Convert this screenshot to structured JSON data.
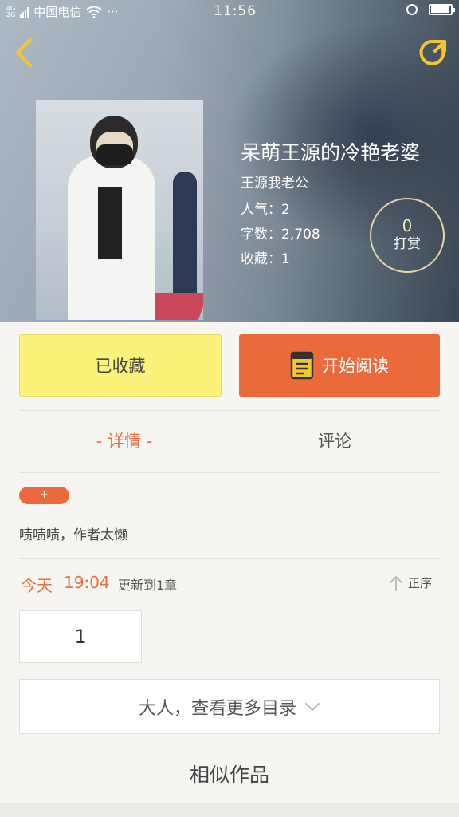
{
  "status_bar": {
    "network_top": "4G",
    "network_bottom": "2G",
    "carrier": "中国电信",
    "more": "···",
    "time": "11:56",
    "icons": [
      "signal-icon",
      "wifi-icon",
      "alarm-icon",
      "battery-icon"
    ]
  },
  "header": {
    "back_icon": "chevron-left-icon",
    "share_icon": "share-icon",
    "accent_color": "#f3c62f"
  },
  "book": {
    "title": "呆萌王源的冷艳老婆",
    "author": "王源我老公",
    "popularity": "人气：2",
    "word_count": "字数：2,708",
    "favorites": "收藏：1",
    "tip_count": "0",
    "tip_label": "打赏"
  },
  "actions": {
    "collect_label": "已收藏",
    "read_label": "开始阅读",
    "collect_color": "#fbf27a",
    "read_color": "#eb6a3c"
  },
  "tabs": {
    "detail": "- 详情 -",
    "comment": "评论"
  },
  "details": {
    "tag": "+",
    "intro": "啧啧啧，作者太懒"
  },
  "update": {
    "day": "今天",
    "time": "19:04",
    "text": "更新到1章",
    "order_label": "正序"
  },
  "chapters": {
    "first": "1",
    "more_label": "大人，查看更多目录"
  },
  "similar": {
    "title": "相似作品"
  }
}
